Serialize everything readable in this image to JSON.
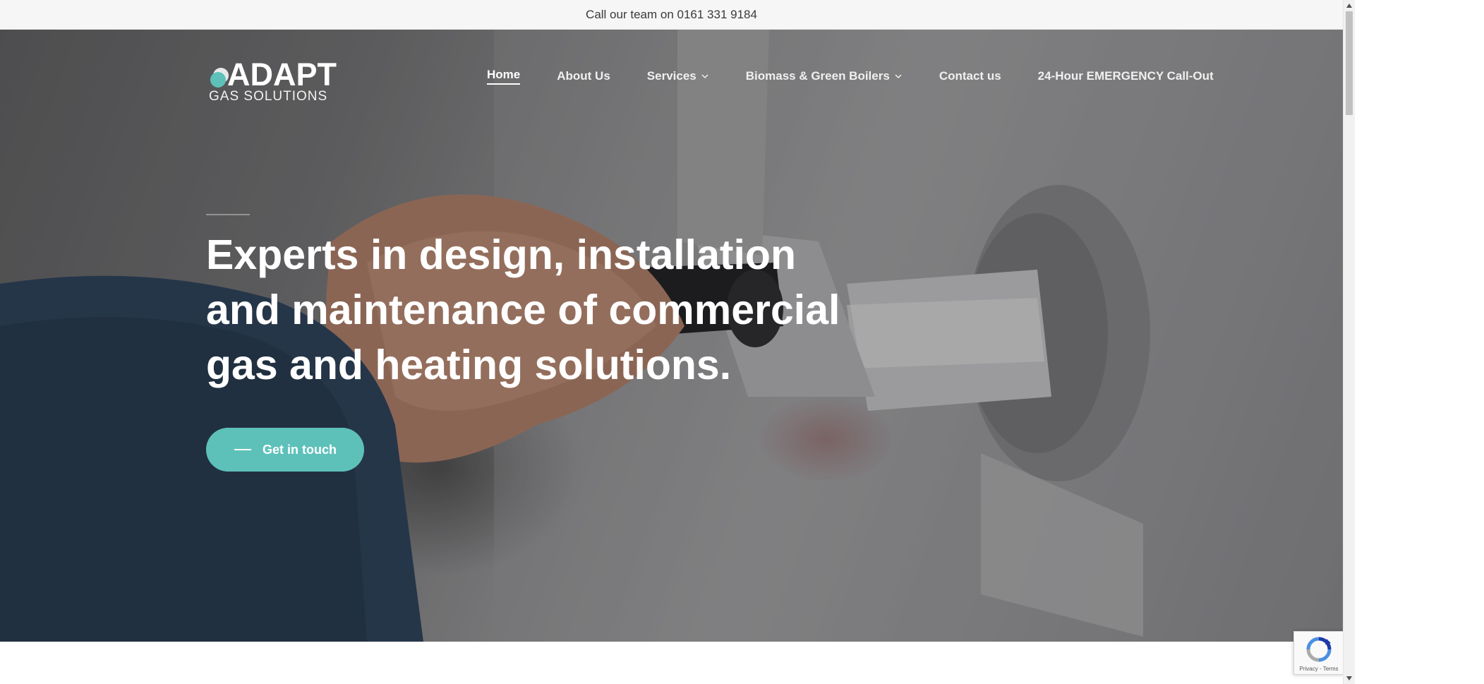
{
  "topbar": {
    "text": "Call our team on 0161 331 9184"
  },
  "logo": {
    "main": "ADAPT",
    "sub": "GAS SOLUTIONS"
  },
  "nav": {
    "items": [
      {
        "label": "Home",
        "active": true,
        "has_dropdown": false
      },
      {
        "label": "About Us",
        "active": false,
        "has_dropdown": false
      },
      {
        "label": "Services",
        "active": false,
        "has_dropdown": true
      },
      {
        "label": "Biomass & Green Boilers",
        "active": false,
        "has_dropdown": true
      },
      {
        "label": "Contact us",
        "active": false,
        "has_dropdown": false
      },
      {
        "label": "24-Hour EMERGENCY Call-Out",
        "active": false,
        "has_dropdown": false
      }
    ]
  },
  "hero": {
    "headline_lines": [
      "Experts in design, installation",
      "and maintenance of commercial",
      "gas and heating solutions."
    ],
    "cta_label": "Get in touch"
  },
  "recaptcha": {
    "text": "Privacy - Terms"
  },
  "colors": {
    "accent": "#5dc1ba",
    "topbar_bg": "#f6f6f6",
    "text_light": "#ffffff"
  },
  "icons": {
    "dropdown": "chevron-down-icon",
    "recaptcha": "recaptcha-icon",
    "scroll_up": "arrow-up-icon",
    "scroll_down": "arrow-down-icon"
  }
}
